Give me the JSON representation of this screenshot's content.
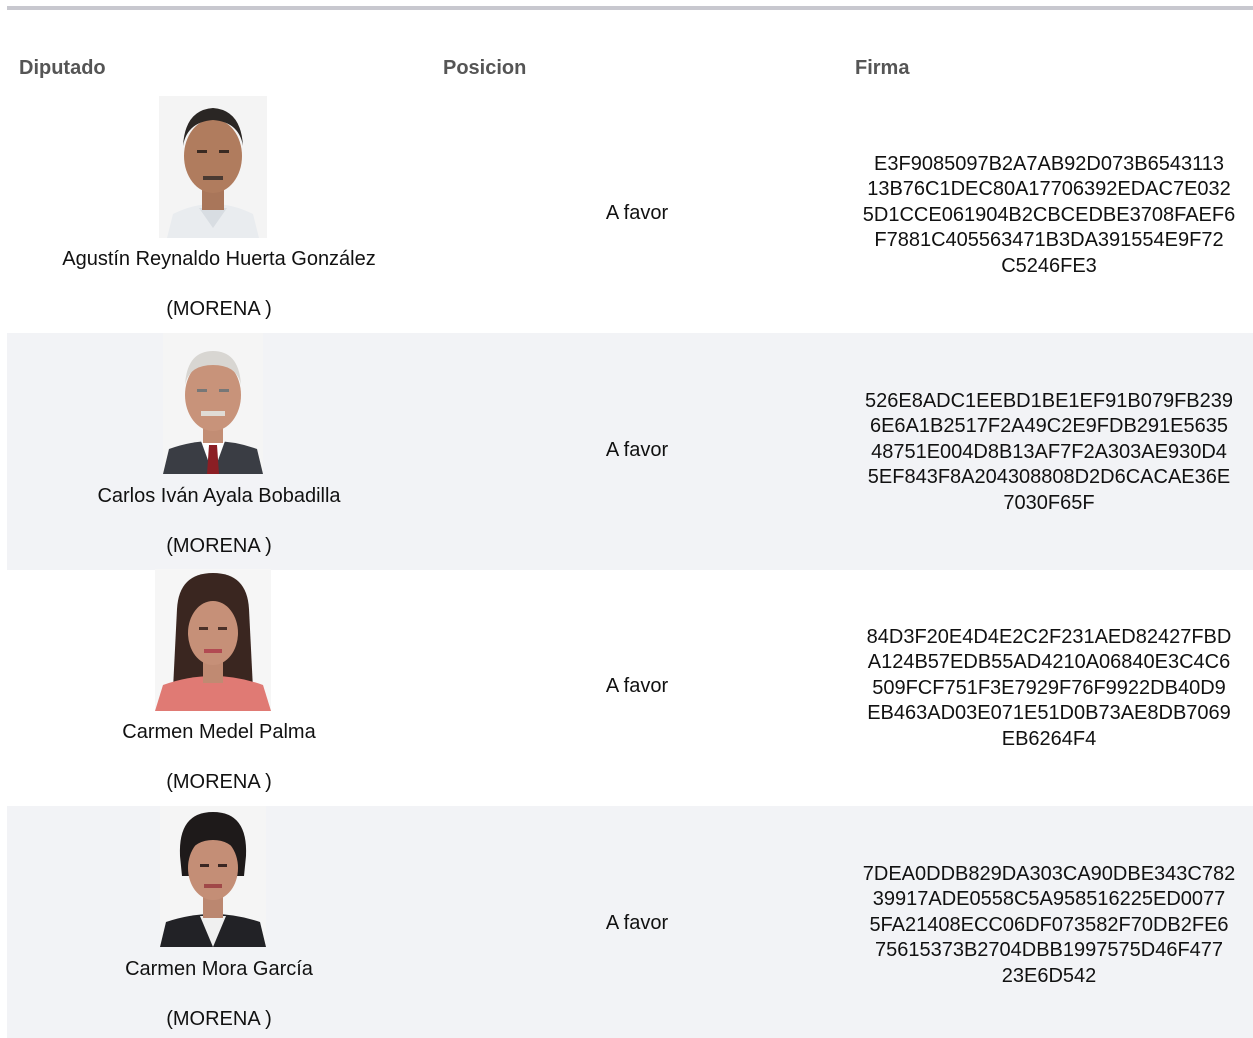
{
  "table": {
    "headers": {
      "diputado": "Diputado",
      "posicion": "Posicion",
      "firma": "Firma"
    },
    "rows": [
      {
        "name": "Agustín Reynaldo Huerta González",
        "party": "(MORENA )",
        "position": "A favor",
        "firma": "E3F9085097B2A7AB92D073B654311313B76C1DEC80A17706392EDAC7E0325D1CCE061904B2CBCEDBE3708FAEF6F7881C405563471B3DA391554E9F72C5246FE3"
      },
      {
        "name": "Carlos Iván Ayala Bobadilla",
        "party": "(MORENA )",
        "position": "A favor",
        "firma": "526E8ADC1EEBD1BE1EF91B079FB2396E6A1B2517F2A49C2E9FDB291E563548751E004D8B13AF7F2A303AE930D45EF843F8A204308808D2D6CACAE36E7030F65F"
      },
      {
        "name": "Carmen Medel Palma",
        "party": "(MORENA )",
        "position": "A favor",
        "firma": "84D3F20E4D4E2C2F231AED82427FBDA124B57EDB55AD4210A06840E3C4C6509FCF751F3E7929F76F9922DB40D9EB463AD03E071E51D0B73AE8DB7069EB6264F4"
      },
      {
        "name": "Carmen Mora García",
        "party": "(MORENA )",
        "position": "A favor",
        "firma": "7DEA0DDB829DA303CA90DBE343C78239917ADE0558C5A958516225ED00775FA21408ECC06DF073582F70DB2FE675615373B2704DBB1997575D46F47723E6D542"
      }
    ]
  },
  "colors": {
    "rule": "#c8c8cf",
    "row_shade": "#f2f3f6",
    "header_text": "#555555"
  }
}
